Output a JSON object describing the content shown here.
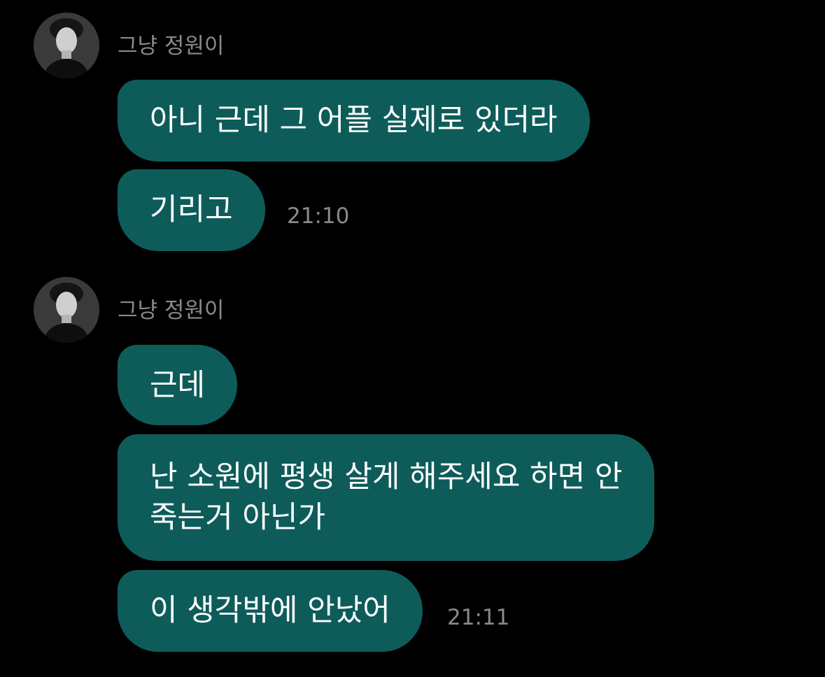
{
  "colors": {
    "background": "#000000",
    "bubble": "#0d5c5a",
    "bubble_text": "#ffffff",
    "meta_text": "#8a8a8a"
  },
  "groups": [
    {
      "sender": "그냥 정원이",
      "avatar_icon": "profile-photo",
      "messages": [
        {
          "text": "아니 근데 그 어플 실제로 있더라"
        },
        {
          "text": "기리고",
          "time": "21:10"
        }
      ]
    },
    {
      "sender": "그냥 정원이",
      "avatar_icon": "profile-photo",
      "messages": [
        {
          "text": "근데"
        },
        {
          "lines": [
            "난 소원에 평생 살게 해주세요 하면 안",
            "죽는거 아닌가"
          ]
        },
        {
          "text": "이 생각밖에 안났어",
          "time": "21:11"
        }
      ]
    }
  ]
}
